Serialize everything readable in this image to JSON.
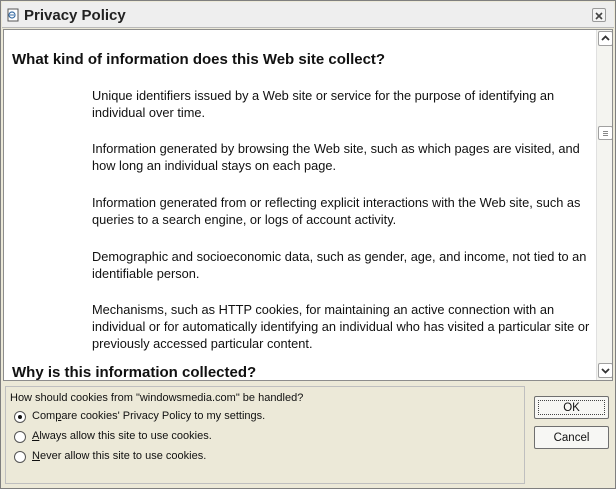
{
  "window": {
    "title": "Privacy Policy",
    "title_icon": "privacy-page-icon",
    "close_icon": "close-icon"
  },
  "content": {
    "heading1": "What kind of information does this Web site collect?",
    "paragraphs": [
      "Unique identifiers issued by a Web site or service for the purpose of identifying an individual over time.",
      "Information generated by browsing the Web site, such as which pages are visited, and how long an individual stays on each page.",
      "Information generated from or reflecting explicit interactions with the Web site, such as queries to a search engine, or logs of account activity.",
      "Demographic and socioeconomic data, such as gender, age, and income, not tied to an identifiable person.",
      "Mechanisms, such as HTTP cookies, for maintaining an active connection with an individual or for automatically identifying an individual who has visited a particular site or previously accessed particular content."
    ],
    "heading2": "Why is this information collected?"
  },
  "scrollbar": {
    "up_icon": "chevron-up-icon",
    "down_icon": "chevron-down-icon",
    "thumb_icon": "grip-icon"
  },
  "cookies": {
    "prompt": "How should cookies from \"windowsmedia.com\" be handled?",
    "options": [
      {
        "label_pre": "Com",
        "label_ul": "p",
        "label_post": "are cookies' Privacy Policy to my settings.",
        "selected": true
      },
      {
        "label_pre": "",
        "label_ul": "A",
        "label_post": "lways allow this site to use cookies.",
        "selected": false
      },
      {
        "label_pre": "",
        "label_ul": "N",
        "label_post": "ever allow this site to use cookies.",
        "selected": false
      }
    ]
  },
  "buttons": {
    "ok": "OK",
    "cancel": "Cancel"
  }
}
